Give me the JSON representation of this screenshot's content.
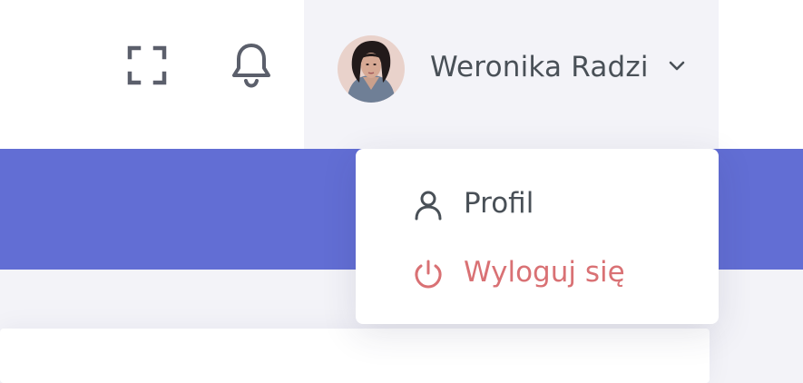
{
  "topbar": {
    "fullscreen_icon": "fullscreen-icon",
    "notifications_icon": "bell-icon"
  },
  "user": {
    "name": "Weronika Radzi",
    "avatar_icon": "user-avatar",
    "menu_toggle_icon": "chevron-down-icon"
  },
  "dropdown": {
    "items": [
      {
        "label": "Profil",
        "icon": "user-icon",
        "color": "#495057"
      },
      {
        "label": "Wyloguj się",
        "icon": "power-icon",
        "color": "#d97174"
      }
    ]
  },
  "colors": {
    "banner": "#626ed4",
    "text": "#495057",
    "danger": "#d97174",
    "topbar_bg": "#ffffff",
    "user_area_bg": "#f3f3f8"
  }
}
